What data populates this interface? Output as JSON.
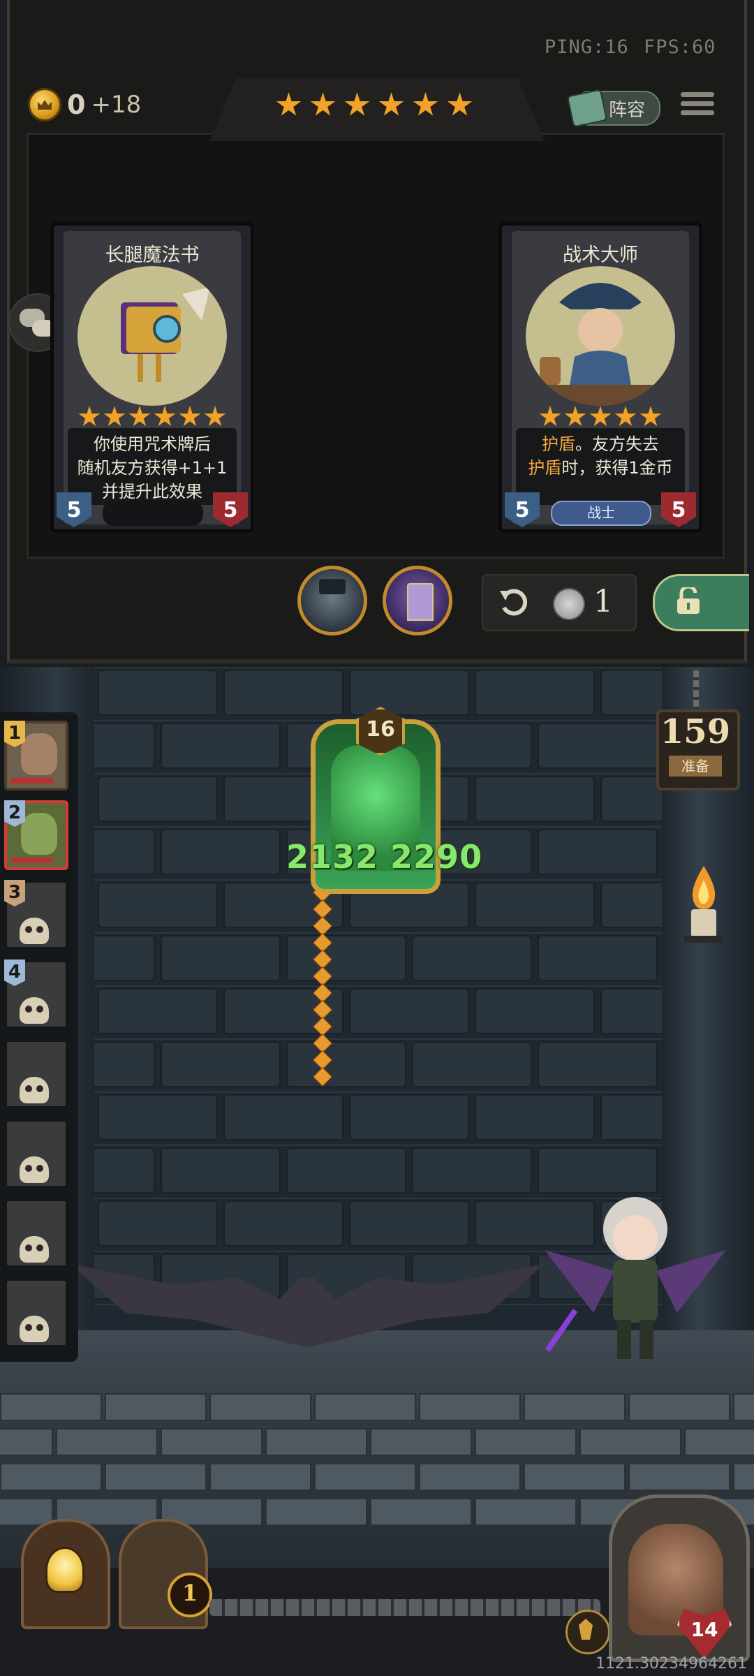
{
  "status": {
    "ping": "PING:16",
    "fps": "FPS:60"
  },
  "gold": {
    "amount": "0",
    "income": "+18"
  },
  "tier_stars": 6,
  "lineup_button": {
    "label": "阵容"
  },
  "shop_cards": [
    {
      "name": "长腿魔法书",
      "stars": 6,
      "description_lines": [
        "你使用咒术牌后",
        "随机友方获得+1+1",
        "并提升此效果"
      ],
      "attack": "5",
      "health": "5",
      "tribe": ""
    },
    {
      "name": "战术大师",
      "stars": 5,
      "description_html_parts": [
        {
          "text": "护盾",
          "hl": true
        },
        {
          "text": "。友方失去",
          "hl": false
        },
        {
          "text": "\n",
          "hl": false
        },
        {
          "text": "护盾",
          "hl": true
        },
        {
          "text": "时，获得1金币",
          "hl": false
        }
      ],
      "attack": "5",
      "health": "5",
      "tribe": "战士"
    }
  ],
  "refresh": {
    "cost": "1"
  },
  "ready_timer": {
    "count": "159",
    "label": "准备"
  },
  "roster": [
    {
      "number": "1",
      "state": "alive"
    },
    {
      "number": "2",
      "state": "active"
    },
    {
      "number": "3",
      "state": "dead"
    },
    {
      "number": "4",
      "state": "dead"
    },
    {
      "number": "",
      "state": "dead"
    },
    {
      "number": "",
      "state": "dead"
    },
    {
      "number": "",
      "state": "dead"
    },
    {
      "number": "",
      "state": "dead"
    }
  ],
  "enemy": {
    "level": "16",
    "stats": "2132 2290"
  },
  "door_count": "1",
  "hero": {
    "health": "14"
  },
  "coords": "1121.30234964261",
  "colors": {
    "accent_gold": "#f2a227",
    "attack_blue": "#3c5f86",
    "health_red": "#9c2a2e",
    "enemy_green": "#88e86b"
  }
}
